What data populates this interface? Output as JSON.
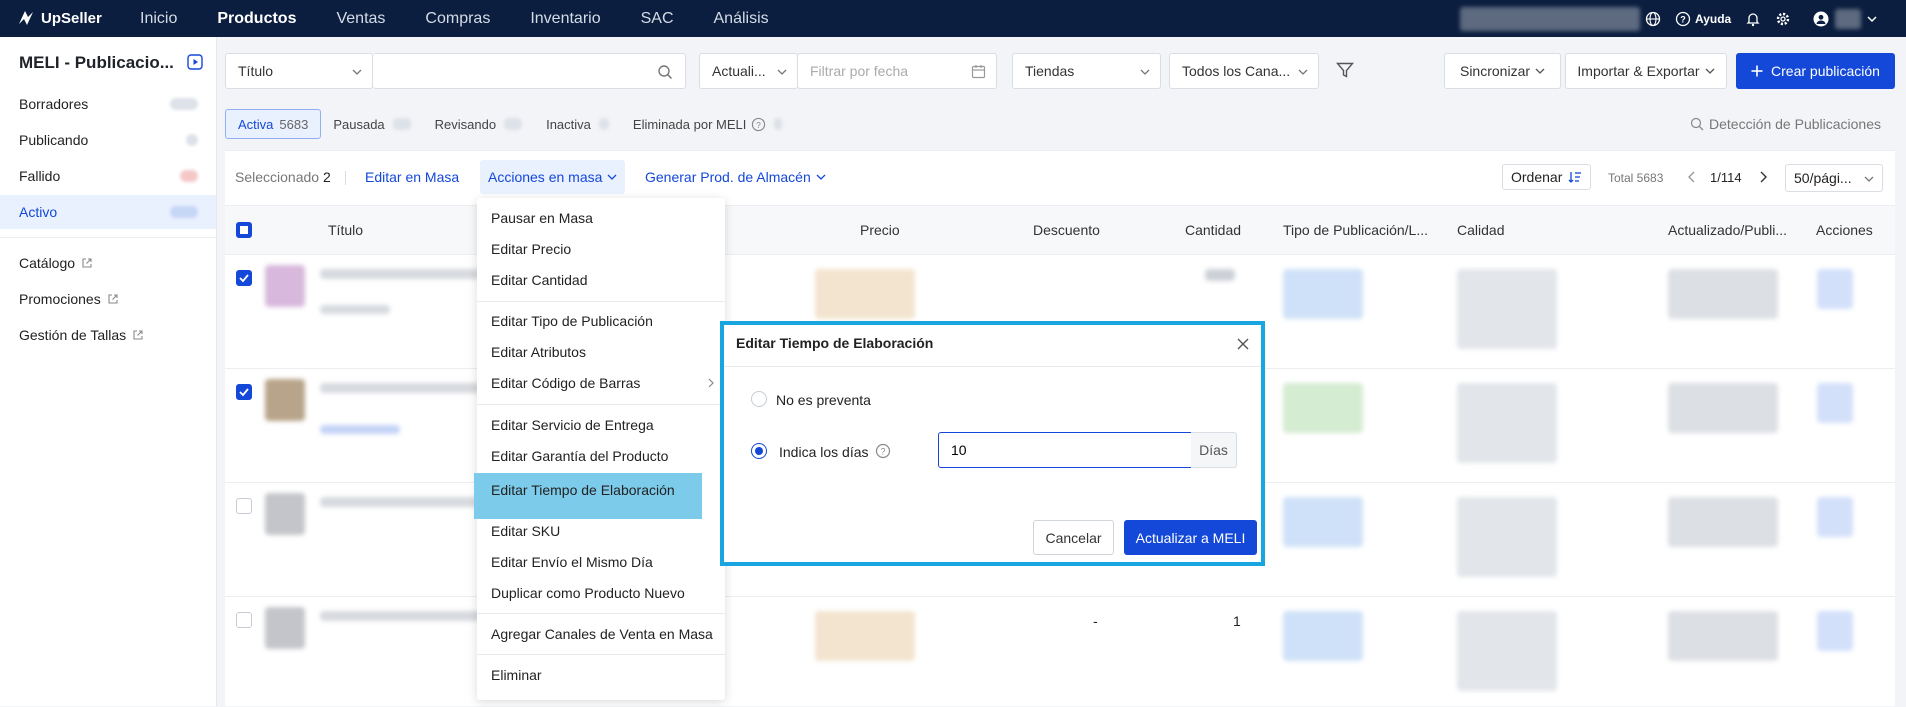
{
  "topbar": {
    "brand": "UpSeller",
    "nav": [
      "Inicio",
      "Productos",
      "Ventas",
      "Compras",
      "Inventario",
      "SAC",
      "Análisis"
    ],
    "active_nav": "Productos",
    "help_label": "Ayuda"
  },
  "sidebar": {
    "title": "MELI - Publicacio...",
    "status_items": [
      "Borradores",
      "Publicando",
      "Fallido",
      "Activo"
    ],
    "selected": "Activo",
    "link_items": [
      "Catálogo",
      "Promociones",
      "Gestión de Tallas"
    ]
  },
  "filters": {
    "title_select": "Título",
    "date_select": "Actuali...",
    "date_placeholder": "Filtrar por fecha",
    "stores": "Tiendas",
    "channels": "Todos los Cana...",
    "sync_button": "Sincronizar",
    "import_export_button": "Importar & Exportar",
    "create_button": "Crear publicación"
  },
  "tabs": [
    {
      "label": "Activa",
      "count": "5683"
    },
    {
      "label": "Pausada",
      "count": ""
    },
    {
      "label": "Revisando",
      "count": ""
    },
    {
      "label": "Inactiva",
      "count": ""
    },
    {
      "label": "Eliminada por MELI",
      "count": ""
    }
  ],
  "detection_link": "Detección de Publicaciones",
  "toolbar": {
    "selected_label": "Seleccionado",
    "selected_count": "2",
    "bulk_edit": "Editar en Masa",
    "bulk_actions": "Acciones en masa",
    "generate": "Generar Prod. de Almacén",
    "sort": "Ordenar",
    "total": "Total 5683",
    "page": "1/114",
    "page_size": "50/pági..."
  },
  "columns": [
    "Título",
    "Precio",
    "Descuento",
    "Cantidad",
    "Tipo de Publicación/L...",
    "Calidad",
    "Actualizado/Publi...",
    "Acciones"
  ],
  "rows": [
    {
      "checked": true,
      "discount": "",
      "quantity": ""
    },
    {
      "checked": true,
      "discount": "",
      "quantity": ""
    },
    {
      "checked": false,
      "discount": "",
      "quantity": ""
    },
    {
      "checked": false,
      "discount": "-",
      "quantity": "1"
    }
  ],
  "bulk_menu": {
    "items": [
      "Pausar en Masa",
      "Editar Precio",
      "Editar Cantidad",
      "Editar Tipo de Publicación",
      "Editar Atributos",
      "Editar Código de Barras",
      "Editar Servicio de Entrega",
      "Editar Garantía del Producto",
      "Editar Tiempo de Elaboración",
      "Editar SKU",
      "Editar Envío el Mismo Día",
      "Duplicar como Producto Nuevo",
      "Agregar Canales de Venta en Masa",
      "Eliminar"
    ],
    "highlighted": "Editar Tiempo de Elaboración"
  },
  "dialog": {
    "title": "Editar Tiempo de Elaboración",
    "option_not_presale": "No es preventa",
    "option_days": "Indica los días",
    "days_value": "10",
    "days_unit": "Días",
    "cancel": "Cancelar",
    "submit": "Actualizar a MELI"
  },
  "colors": {
    "primary": "#1448d9",
    "topbar": "#0b1e3f",
    "highlight": "#7ccbeb",
    "dialog_border": "#19a6e0"
  }
}
